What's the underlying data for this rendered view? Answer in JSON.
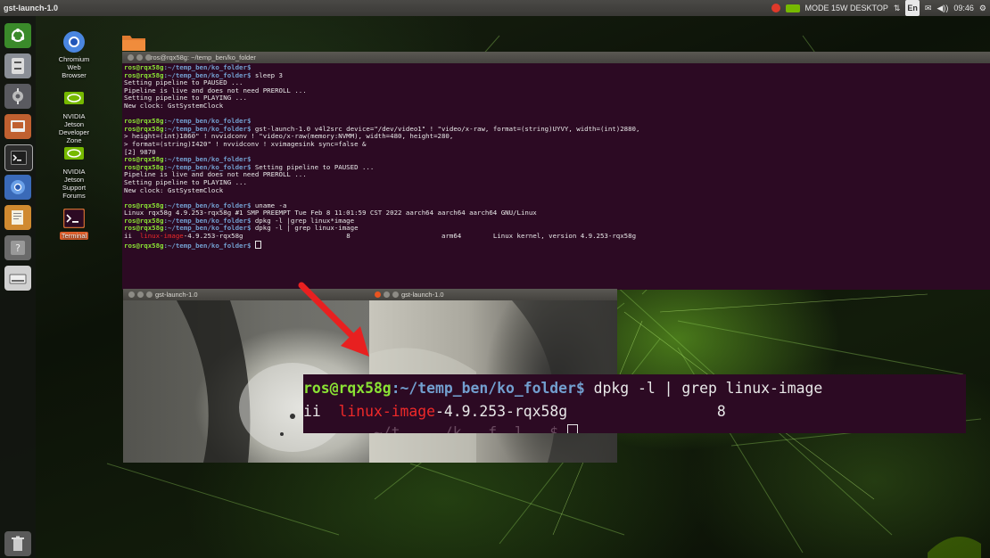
{
  "panel": {
    "app_title": "gst-launch-1.0",
    "network_label": "MODE 15W DESKTOP",
    "keyboard_layout": "En",
    "clock": "09:46"
  },
  "desktop_icons": [
    {
      "label": "Chromium\nWeb\nBrowser"
    },
    {
      "label": "NVIDIA\nJetson\nDeveloper\nZone"
    },
    {
      "label": "NVIDIA\nJetson\nSupport\nForums"
    },
    {
      "label": "Terminal"
    }
  ],
  "terminal": {
    "title": "ros@rqx58g: ~/temp_ben/ko_folder",
    "prompt_user": "ros@rqx58g",
    "prompt_path": ":~/temp_ben/ko_folder$",
    "lines": [
      {
        "prompt": true,
        "cmd": ""
      },
      {
        "prompt": true,
        "cmd": " sleep 3"
      },
      {
        "text": "Setting pipeline to PAUSED ..."
      },
      {
        "text": "Pipeline is live and does not need PREROLL ..."
      },
      {
        "text": "Setting pipeline to PLAYING ..."
      },
      {
        "text": "New clock: GstSystemClock"
      },
      {
        "text": ""
      },
      {
        "prompt": true,
        "cmd": ""
      },
      {
        "prompt": true,
        "cmd": " gst-launch-1.0 v4l2src device=\"/dev/video1\" ! \"video/x-raw, format=(string)UYVY, width=(int)2880,"
      },
      {
        "text": "> height=(int)1860\" ! nvvidconv ! \"video/x-raw(memory:NVMM), width=480, height=280,"
      },
      {
        "text": "> format=(string)I420\" ! nvvidconv ! xvimagesink sync=false &"
      },
      {
        "text": "[2] 9870"
      },
      {
        "prompt": true,
        "cmd": ""
      },
      {
        "prompt": true,
        "cmd": " Setting pipeline to PAUSED ..."
      },
      {
        "text": "Pipeline is live and does not need PREROLL ..."
      },
      {
        "text": "Setting pipeline to PLAYING ..."
      },
      {
        "text": "New clock: GstSystemClock"
      },
      {
        "text": ""
      },
      {
        "prompt": true,
        "cmd": " uname -a"
      },
      {
        "text": "Linux rqx58g 4.9.253-rqx58g #1 SMP PREEMPT Tue Feb 8 11:01:59 CST 2022 aarch64 aarch64 aarch64 GNU/Linux"
      },
      {
        "prompt": true,
        "cmd": " dpkg -l |grep linux*image"
      },
      {
        "prompt": true,
        "cmd": " dpkg -l | grep linux-image"
      },
      {
        "pkg": true,
        "status": "ii  ",
        "name_hl": "linux-image",
        "name_rest": "-4.9.253-rqx58g",
        "version": "                          8",
        "arch": "                       arm64",
        "desc": "        Linux kernel, version 4.9.253-rqx58g"
      },
      {
        "prompt": true,
        "cmd": " ",
        "cursor": true
      }
    ]
  },
  "video_windows": [
    {
      "title": "gst-launch-1.0"
    },
    {
      "title": "gst-launch-1.0"
    }
  ],
  "zoom": {
    "line1_user": "ros@rqx58g",
    "line1_path": ":~/temp_ben/ko_folder$",
    "line1_cmd": " dpkg -l | grep linux-image",
    "line2_status": "ii  ",
    "line2_hl": "linux-image",
    "line2_rest": "-4.9.253-rqx58g",
    "line2_version": "                 8",
    "line3_partial": "        ~/t     /k   f  l   $ "
  },
  "colors": {
    "terminal_bg": "#2c0a23",
    "prompt_user": "#8ae234",
    "prompt_path": "#729fcf",
    "highlight": "#ef2929",
    "arrow": "#e82020",
    "nvidia_green": "#76b900"
  }
}
